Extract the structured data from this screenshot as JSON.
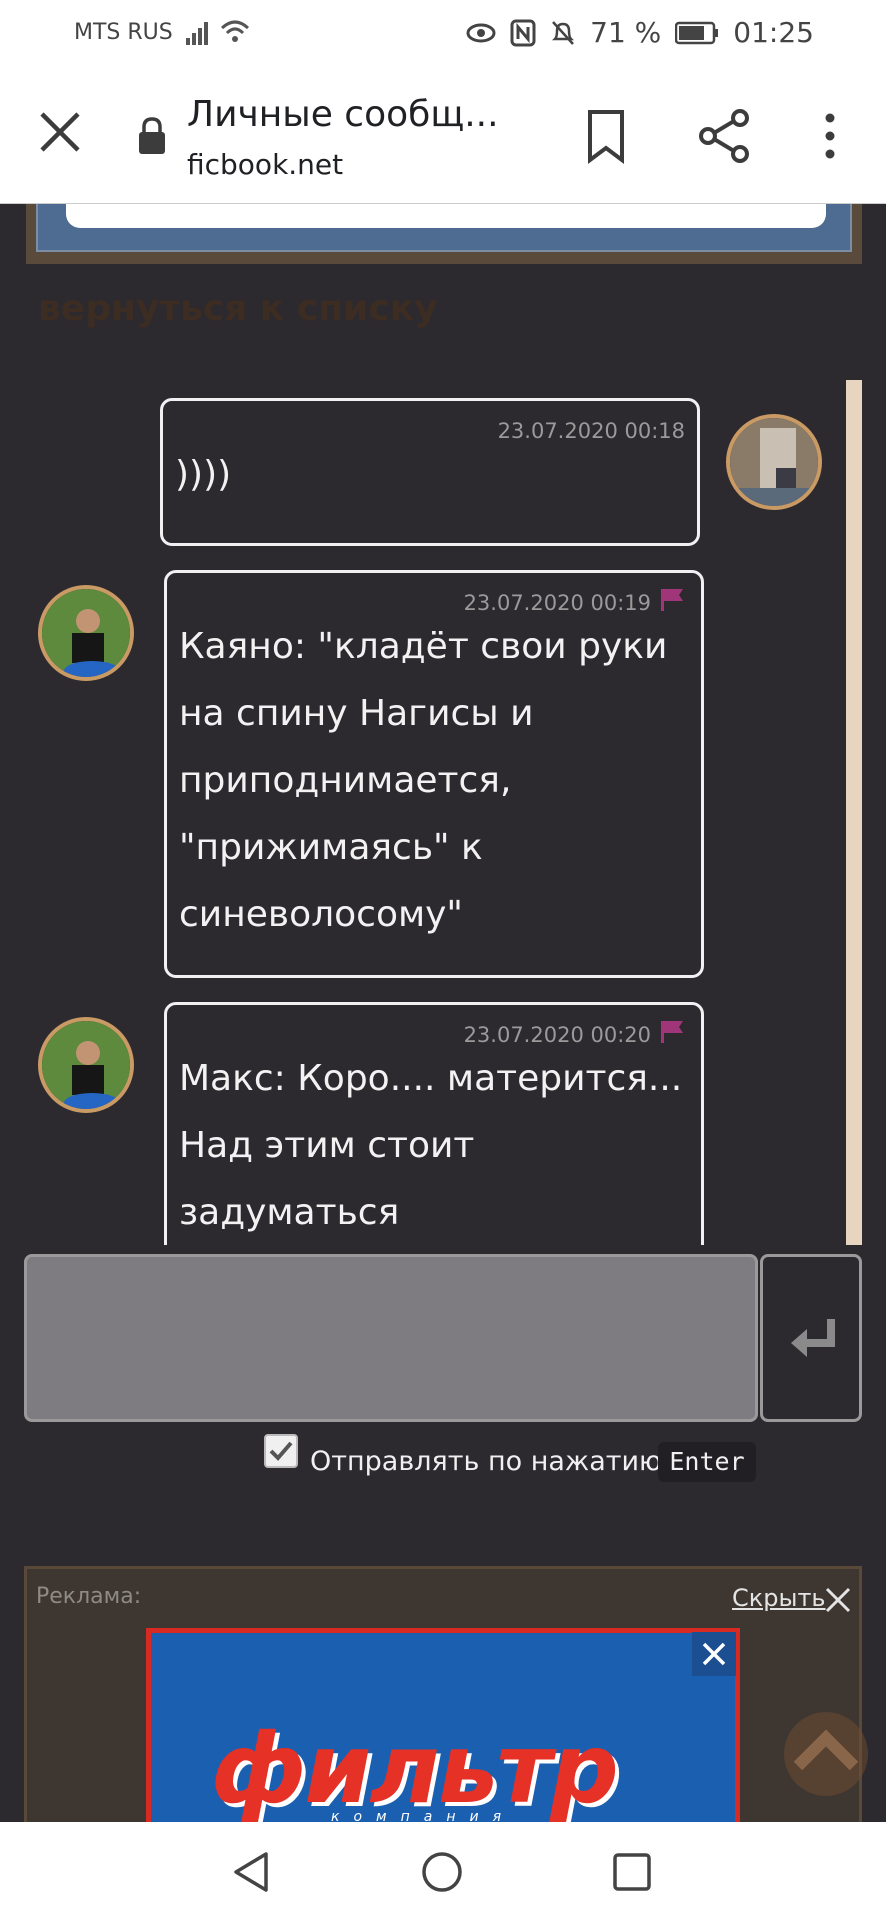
{
  "status_bar": {
    "carrier": "MTS RUS",
    "battery": "71 %",
    "time": "01:25"
  },
  "browser": {
    "title": "Личные сообщ...",
    "domain": "ficbook.net"
  },
  "page": {
    "back_link": "вернуться к списку"
  },
  "messages": [
    {
      "date": "23.07.2020 00:18",
      "text": "))))",
      "side": "right",
      "flag": false
    },
    {
      "date": "23.07.2020 00:19",
      "text": "Каяно: \"кладёт свои руки\nна спину Нагисы и\nприподнимается,\n\"прижимаясь\" к\nсиневолосому\"",
      "side": "left",
      "flag": true
    },
    {
      "date": "23.07.2020 00:20",
      "text": "Макс: Коро.... матерится...\nНад этим стоит\nзадуматься",
      "side": "left",
      "flag": true
    }
  ],
  "composer": {
    "send_on_enter_label": "Отправлять по нажатию",
    "enter_key": "Enter",
    "send_on_enter_checked": true
  },
  "ad": {
    "label": "Реклама:",
    "hide_label": "Скрыть",
    "banner_logo": "фильтр",
    "banner_sub": "компания"
  },
  "colors": {
    "page_bg": "#2c2a2f",
    "avatar_border": "#c99a64",
    "flag": "#a0357a",
    "banner_red": "#d62a22",
    "banner_blue": "#1a5fb0"
  }
}
